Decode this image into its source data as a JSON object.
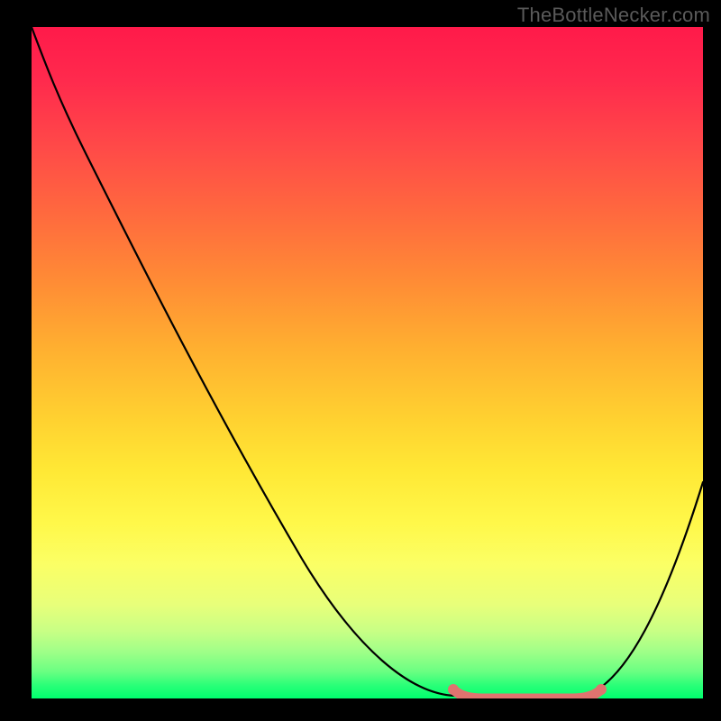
{
  "watermark": "TheBottleNecker.com",
  "chart_data": {
    "type": "line",
    "title": "",
    "xlabel": "",
    "ylabel": "",
    "xlim": [
      0,
      100
    ],
    "ylim": [
      0,
      100
    ],
    "grid": false,
    "legend": false,
    "series": [
      {
        "name": "bottleneck-curve",
        "color": "#000000",
        "x": [
          0,
          5,
          10,
          15,
          20,
          25,
          30,
          35,
          40,
          45,
          50,
          55,
          60,
          64,
          68,
          72,
          76,
          80,
          84,
          88,
          92,
          96,
          100
        ],
        "y": [
          100,
          93,
          85,
          77,
          69,
          61,
          53,
          45,
          37,
          29,
          21,
          14,
          8,
          4,
          1,
          0,
          0,
          0,
          1,
          5,
          12,
          22,
          35
        ]
      },
      {
        "name": "optimal-range-highlight",
        "color": "#e0736f",
        "x": [
          68,
          72,
          76,
          80,
          84
        ],
        "y": [
          1,
          0,
          0,
          0,
          1
        ]
      }
    ],
    "gradient": {
      "orientation": "vertical",
      "stops": [
        {
          "pos": 0.0,
          "color": "#ff1a4a"
        },
        {
          "pos": 0.5,
          "color": "#ffd030"
        },
        {
          "pos": 0.8,
          "color": "#fbff65"
        },
        {
          "pos": 1.0,
          "color": "#00ff6e"
        }
      ]
    }
  }
}
